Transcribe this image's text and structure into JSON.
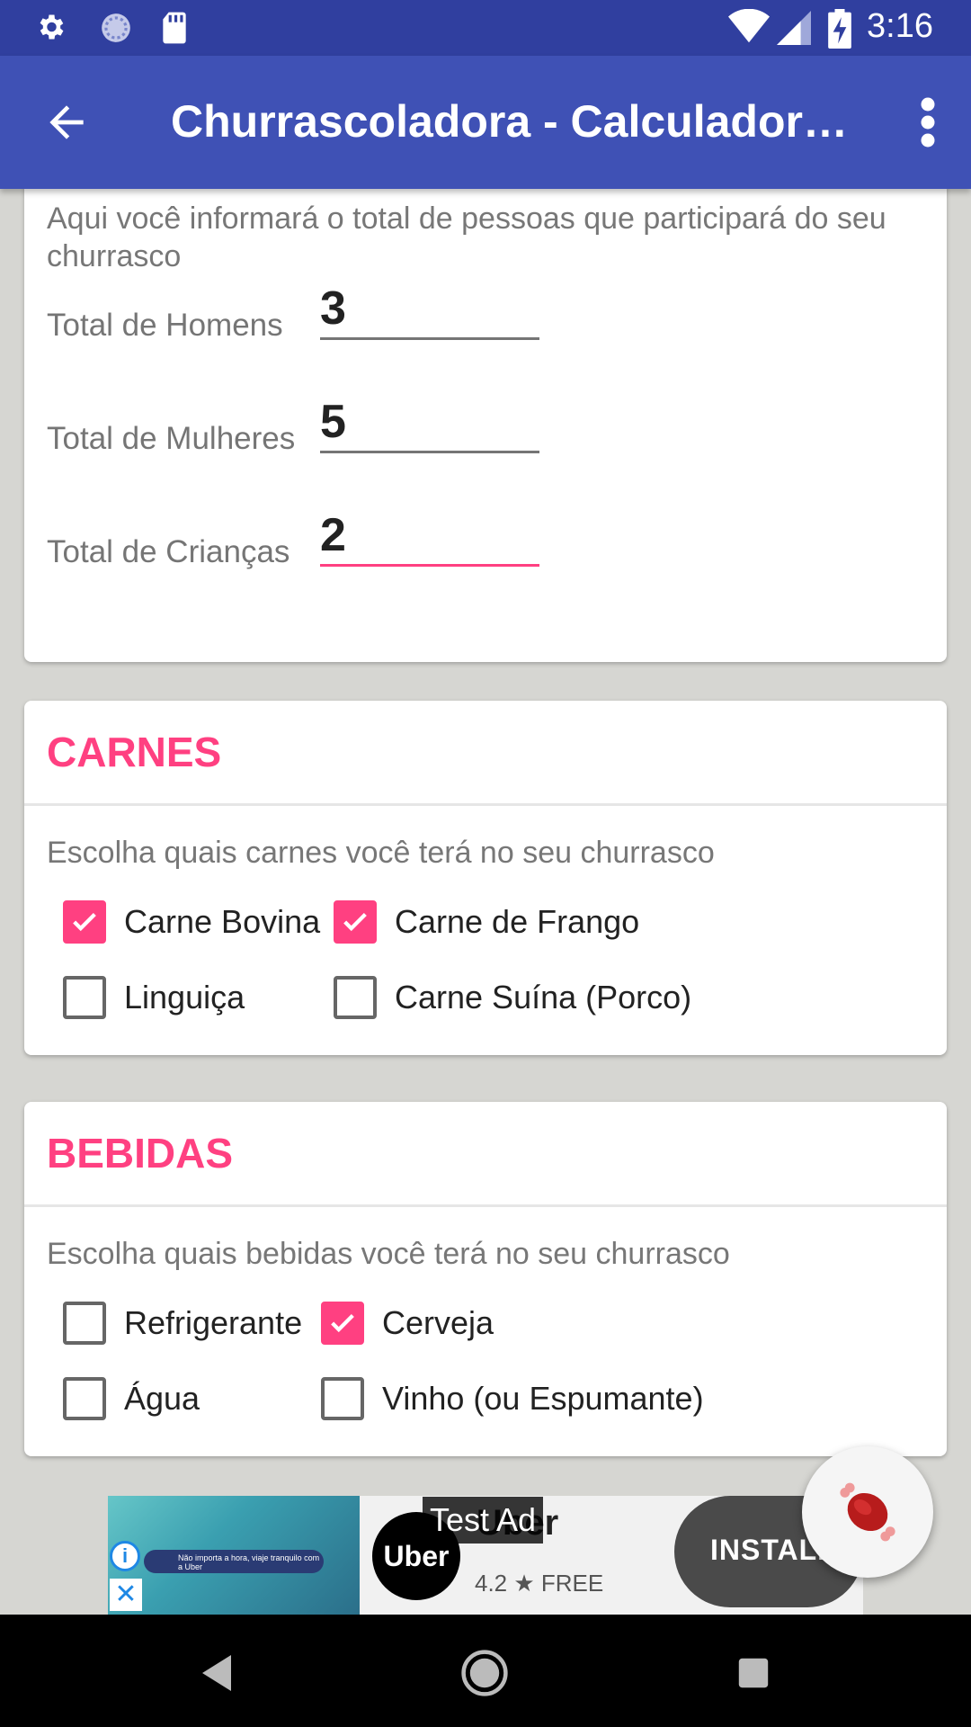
{
  "status_bar": {
    "time": "3:16",
    "left_icons": [
      "gear-icon",
      "sync-icon",
      "sd-card-icon"
    ],
    "right_icons": [
      "wifi-icon",
      "signal-icon",
      "battery-charging-icon"
    ]
  },
  "app_bar": {
    "title": "Churrascoladora - Calculadora de Churrasco",
    "back_icon": "arrow-back-icon",
    "menu_icon": "more-vert-icon"
  },
  "people": {
    "description": "Aqui você informará o total de pessoas que participará do seu churrasco",
    "men": {
      "label": "Total de Homens",
      "value": "3"
    },
    "women": {
      "label": "Total de Mulheres",
      "value": "5"
    },
    "children": {
      "label": "Total de Crianças",
      "value": "2",
      "focused": true
    }
  },
  "meats": {
    "title": "CARNES",
    "description": "Escolha quais carnes você terá no seu churrasco",
    "options": [
      {
        "label": "Carne Bovina",
        "checked": true
      },
      {
        "label": "Carne de Frango",
        "checked": true
      },
      {
        "label": "Linguiça",
        "checked": false
      },
      {
        "label": "Carne Suína (Porco)",
        "checked": false
      }
    ]
  },
  "drinks": {
    "title": "BEBIDAS",
    "description": "Escolha quais bebidas você terá no seu churrasco",
    "options": [
      {
        "label": "Refrigerante",
        "checked": false
      },
      {
        "label": "Cerveja",
        "checked": true
      },
      {
        "label": "Água",
        "checked": false
      },
      {
        "label": "Vinho (ou Espumante)",
        "checked": false
      }
    ]
  },
  "ad": {
    "test_label": "Test Ad",
    "app_name": "Uber",
    "logo_text": "Uber",
    "rating": "4.2 ★ FREE",
    "install": "INSTALL",
    "banner_text": "Não importa a hora, viaje tranquilo com a Uber"
  },
  "fab": {
    "icon": "meat-icon"
  },
  "colors": {
    "primary": "#3f51b5",
    "primary_dark": "#303f9f",
    "accent": "#ff4081"
  }
}
